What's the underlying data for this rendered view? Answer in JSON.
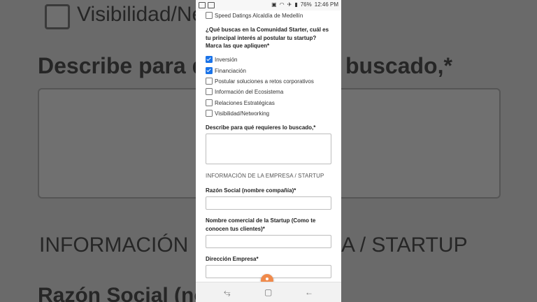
{
  "background": {
    "visibility_text": "Visibilidad/Ne",
    "describe_text": "Describe para qu",
    "describe_tail": "buscado,*",
    "section_left": "INFORMACIÓN",
    "section_right": "A / STARTUP",
    "razon_text": "Razón Social (non"
  },
  "status_bar": {
    "battery": "76%",
    "time": "12:46 PM"
  },
  "form": {
    "top_option": {
      "label": "Speed Datings Alcaldía de Medellín",
      "checked": false
    },
    "question": "¿Qué buscas en la Comunidad Starter, cuál es tu principal interés al postular tu startup? Marca las que apliquen*",
    "options": [
      {
        "label": "Inversión",
        "checked": true
      },
      {
        "label": "Financiación",
        "checked": true
      },
      {
        "label": "Postular soluciones a retos corporativos",
        "checked": false
      },
      {
        "label": "Información del Ecosistema",
        "checked": false
      },
      {
        "label": "Relaciones Estratégicas",
        "checked": false
      },
      {
        "label": "Visibilidad/Networking",
        "checked": false
      }
    ],
    "describe_label": "Describe para qué requieres lo buscado,*",
    "describe_value": "",
    "section_title": "INFORMACIÓN DE LA EMPRESA / STARTUP",
    "razon_label": "Razón Social (nombre compañía)*",
    "razon_value": "",
    "nombre_label": "Nombre comercial de la Startup (Como te conocen tus clientes)*",
    "nombre_value": "",
    "direccion_label": "Dirección Empresa*",
    "direccion_value": ""
  },
  "nav_bar": {
    "recent_icon": "⥃",
    "home_icon": "▢",
    "back_icon": "←"
  }
}
